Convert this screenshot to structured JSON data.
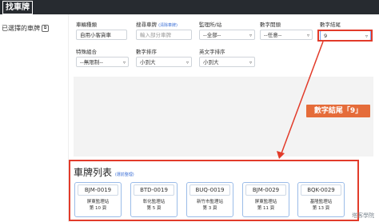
{
  "header": {
    "logo": "找車牌"
  },
  "sidebar": {
    "selected_link": "已選擇的車牌"
  },
  "filters": {
    "vehicle_type": {
      "label": "車輛種類",
      "value": "自用小客貨車"
    },
    "search_plate": {
      "label": "搜尋車牌",
      "sub": "(清除車牌)",
      "placeholder": "輸入部分車牌"
    },
    "station": {
      "label": "監理所/站",
      "value": "--全部--"
    },
    "digit_start": {
      "label": "數字開頭",
      "value": "--任意--"
    },
    "digit_end": {
      "label": "數字結尾",
      "value": "9"
    },
    "special": {
      "label": "特殊組合",
      "value": "--無限制--"
    },
    "digit_sort": {
      "label": "數字排序",
      "value": "小到大"
    },
    "alpha_sort": {
      "label": "英文字排序",
      "value": "小到大"
    }
  },
  "annotation": "數字結尾「9」",
  "plate_list": {
    "title": "車牌列表",
    "hint": "(選前整理)",
    "items": [
      {
        "plate": "BJM-0019",
        "station": "屏東監理站",
        "page": "第 10 頁"
      },
      {
        "plate": "BTD-0019",
        "station": "彰化監理站",
        "page": "第 5 頁"
      },
      {
        "plate": "BUQ-0019",
        "station": "新竹市監理站",
        "page": "第 3 頁"
      },
      {
        "plate": "BJM-0029",
        "station": "屏東監理站",
        "page": "第 11 頁"
      },
      {
        "plate": "BQK-0029",
        "station": "基隆監理站",
        "page": "第 13 頁"
      }
    ]
  },
  "watermark": "塔客學院",
  "colors": {
    "accent_red": "#e23b2a",
    "annotation_orange": "#e56c3a",
    "card_border": "#9bbce8"
  }
}
